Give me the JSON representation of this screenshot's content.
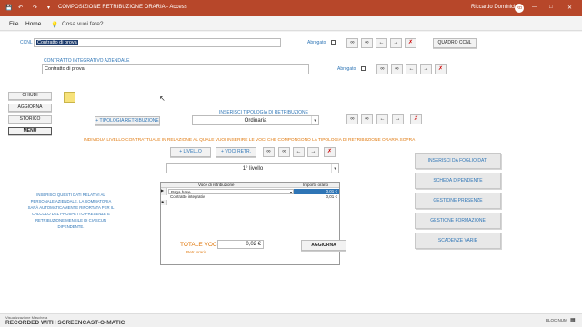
{
  "app": {
    "title": "COMPOSIZIONE RETRIBUZIONE ORARIA - Access",
    "user": "Riccardo Dominici IT",
    "avatar_initials": "RD",
    "accent": "#b7472a"
  },
  "ribbon": {
    "tabs": [
      "File",
      "Home"
    ],
    "search_placeholder": "Cosa vuoi fare?"
  },
  "ccnl": {
    "label": "CCNL",
    "value": "Contratto di prova",
    "abrogato_label": "Abrogato",
    "quadro_button": "QUADRO CCNL"
  },
  "integrativo": {
    "label": "CONTRATTO INTEGRATIVO AZIENDALE",
    "value": "Contratto di prova",
    "abrogato_label": "Abrogato"
  },
  "left_menu": [
    "CHIUDI",
    "AGGIORNA",
    "STORICO",
    "MENU"
  ],
  "tipologia": {
    "button": "+ TIPOLOGIA RETRIBUZIONE",
    "label": "INSERISCI TIPOLOGIA DI RETRIBUZIONE",
    "value": "Ordinaria"
  },
  "instruction": "INDIVIDUA LIVELLO CONTRATTUALE IN RELAZIONE AL QUALE VUOI INSERIRE LE VOCI CHE COMPONGONO LA TIPOLOGIA DI RETRIBUZIONE ORARIA SOPRA",
  "livello": {
    "add_livello": "+ LIVELLO",
    "add_voci": "+ VOCI RETR.",
    "value": "1° livello"
  },
  "nav_icons": [
    "binoculars-icon",
    "binoculars-icon",
    "arrow-left-icon",
    "arrow-right-icon",
    "delete-icon"
  ],
  "table": {
    "col_voce": "Voce di retribuzione",
    "col_importo": "Importo orario",
    "rows": [
      {
        "voce": "Paga base",
        "importo": "0,01 €"
      },
      {
        "voce": "Contratto integrativ",
        "importo": "0,01 €"
      }
    ]
  },
  "note": "INSERISCI QUESTI DATI RELATIVI AL PERSONALE AZIENDALE. LA SOMMATORIA SARÀ AUTOMATICAMENTE RIPORTATA PER IL CALCOLO DEL PROSPETTO PRESENZE E RETRIBUZIONE MENSILE DI CIASCUN DIPENDENTE.",
  "totale": {
    "label": "TOTALE VOCI",
    "sub": "Retr. oraria",
    "value": "0,02 €",
    "aggiorna": "AGGIORNA"
  },
  "right_buttons": [
    "INSERISCI DA FOGLIO DATI",
    "SCHEDA DIPENDENTE",
    "GESTIONE PRESENZE",
    "GESTIONE FORMAZIONE",
    "SCADENZE VARIE"
  ],
  "status": {
    "left": "Visualizzazione Maschera",
    "right": "BLOC NUM",
    "watermark": "RECORDED WITH SCREENCAST-O-MATIC"
  }
}
